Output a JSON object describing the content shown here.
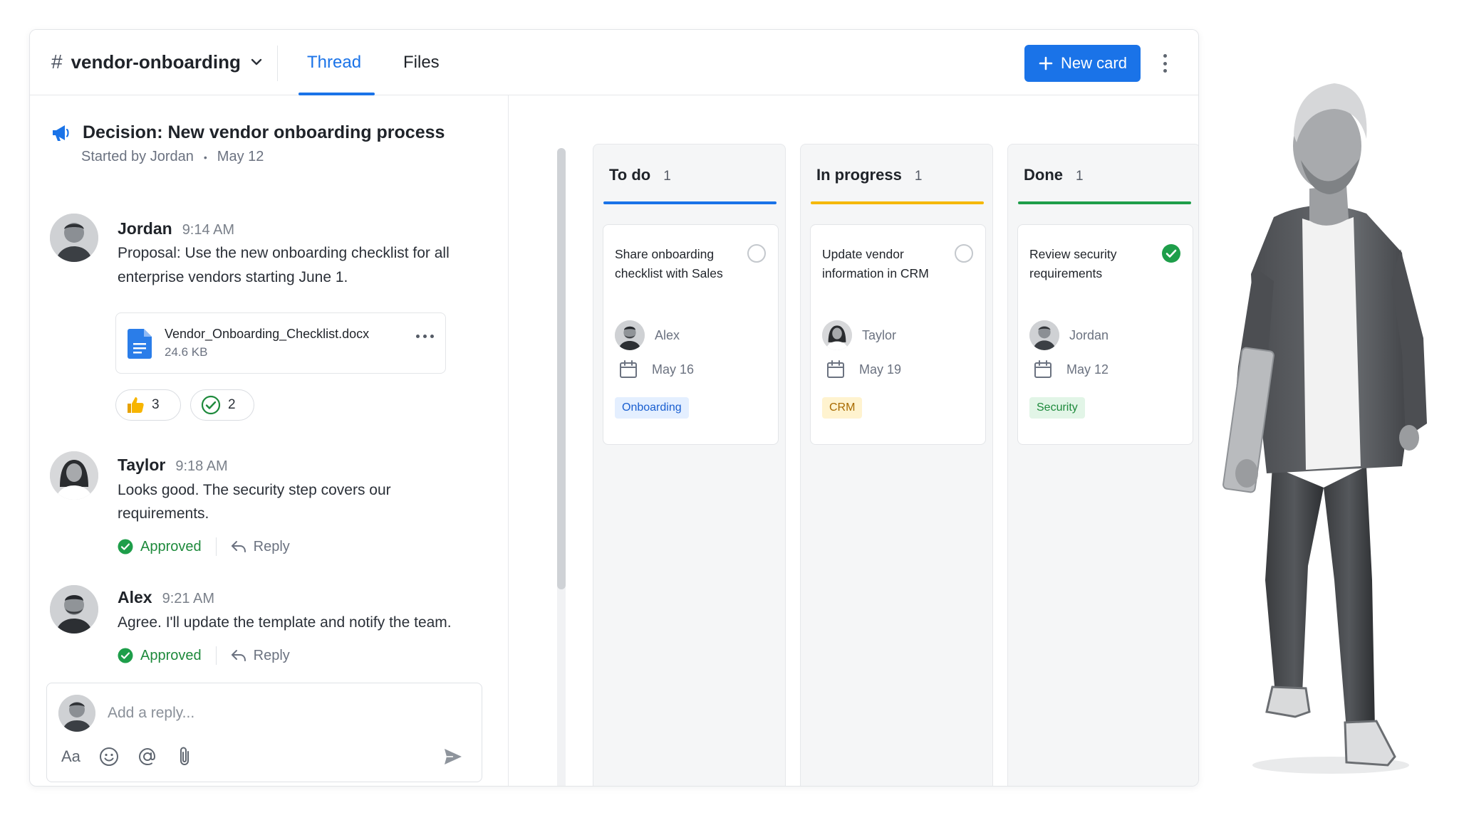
{
  "header": {
    "channel_hash": "#",
    "channel_name": "vendor-onboarding",
    "tabs": [
      {
        "label": "Thread",
        "active": true
      },
      {
        "label": "Files",
        "active": false
      }
    ],
    "new_card_label": "New card",
    "accent_color": "#1a73e8"
  },
  "thread": {
    "title": "Decision: New vendor onboarding process",
    "started_by": "Started by Jordan",
    "started_date": "May 12",
    "messages": [
      {
        "author": "Jordan",
        "time": "9:14 AM",
        "text": "Proposal: Use the new onboarding checklist for all enterprise vendors starting June 1.",
        "attachment": {
          "name": "Vendor_Onboarding_Checklist.docx",
          "size": "24.6 KB"
        },
        "reactions": [
          {
            "icon": "thumbs-up-icon",
            "count": "3"
          },
          {
            "icon": "check-circle-icon",
            "count": "2"
          }
        ]
      },
      {
        "author": "Taylor",
        "time": "9:18 AM",
        "text": "Looks good. The security step covers our requirements.",
        "status": "Approved",
        "reply_label": "Reply"
      },
      {
        "author": "Alex",
        "time": "9:21 AM",
        "text": "Agree. I'll update the template and notify the team.",
        "status": "Approved",
        "reply_label": "Reply"
      }
    ],
    "composer": {
      "placeholder": "Add a reply...",
      "format_label": "Aa"
    }
  },
  "board": {
    "columns": [
      {
        "name": "To do",
        "count": "1",
        "color": "#1a73e8",
        "card": {
          "title": "Share onboarding checklist with Sales",
          "done": false,
          "assignee": "Alex",
          "due": "May 16",
          "tag": "Onboarding",
          "tag_bg": "#e4efff",
          "tag_fg": "#1a5fd0"
        }
      },
      {
        "name": "In progress",
        "count": "1",
        "color": "#f5b800",
        "card": {
          "title": "Update vendor information in CRM",
          "done": false,
          "assignee": "Taylor",
          "due": "May 19",
          "tag": "CRM",
          "tag_bg": "#fff3cf",
          "tag_fg": "#a86a00"
        }
      },
      {
        "name": "Done",
        "count": "1",
        "color": "#1e9e4a",
        "card": {
          "title": "Review security requirements",
          "done": true,
          "assignee": "Jordan",
          "due": "May 12",
          "tag": "Security",
          "tag_bg": "#e2f5e7",
          "tag_fg": "#1e8a3c"
        }
      }
    ]
  },
  "status_colors": {
    "approved": "#1e8a3c",
    "done_check": "#1e9e4a"
  }
}
